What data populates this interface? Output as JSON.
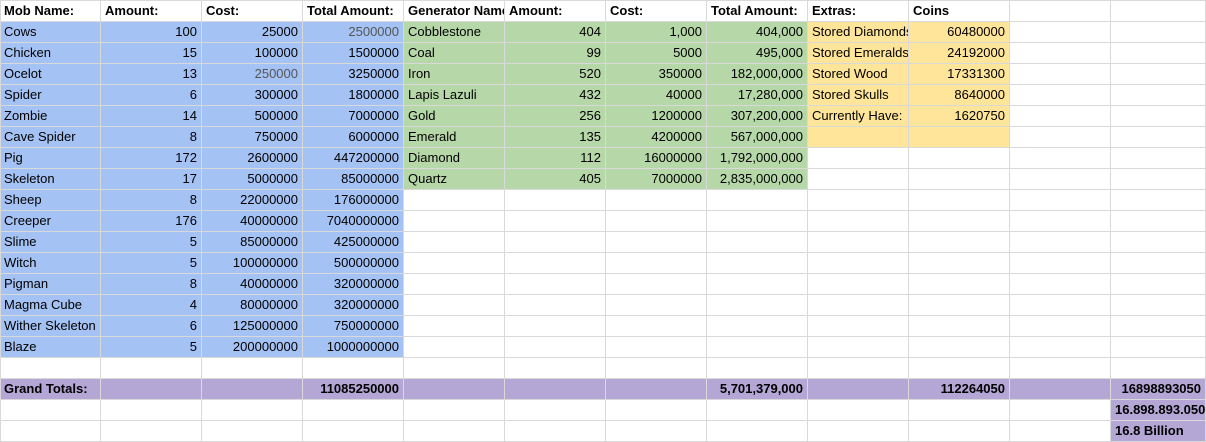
{
  "headers": [
    "Mob Name:",
    "Amount:",
    "Cost:",
    "Total Amount:",
    "Generator Name:",
    "Amount:",
    "Cost:",
    "Total Amount:",
    "Extras:",
    "Coins",
    ""
  ],
  "mobs": [
    {
      "name": "Cows",
      "amount": "100",
      "cost": "25000",
      "total": "2500000"
    },
    {
      "name": "Chicken",
      "amount": "15",
      "cost": "100000",
      "total": "1500000"
    },
    {
      "name": "Ocelot",
      "amount": "13",
      "cost": "250000",
      "total": "3250000"
    },
    {
      "name": "Spider",
      "amount": "6",
      "cost": "300000",
      "total": "1800000"
    },
    {
      "name": "Zombie",
      "amount": "14",
      "cost": "500000",
      "total": "7000000"
    },
    {
      "name": "Cave Spider",
      "amount": "8",
      "cost": "750000",
      "total": "6000000"
    },
    {
      "name": "Pig",
      "amount": "172",
      "cost": "2600000",
      "total": "447200000"
    },
    {
      "name": "Skeleton",
      "amount": "17",
      "cost": "5000000",
      "total": "85000000"
    },
    {
      "name": "Sheep",
      "amount": "8",
      "cost": "22000000",
      "total": "176000000"
    },
    {
      "name": "Creeper",
      "amount": "176",
      "cost": "40000000",
      "total": "7040000000"
    },
    {
      "name": "Slime",
      "amount": "5",
      "cost": "85000000",
      "total": "425000000"
    },
    {
      "name": "Witch",
      "amount": "5",
      "cost": "100000000",
      "total": "500000000"
    },
    {
      "name": "Pigman",
      "amount": "8",
      "cost": "40000000",
      "total": "320000000"
    },
    {
      "name": "Magma Cube",
      "amount": "4",
      "cost": "80000000",
      "total": "320000000"
    },
    {
      "name": "Wither Skeleton",
      "amount": "6",
      "cost": "125000000",
      "total": "750000000"
    },
    {
      "name": "Blaze",
      "amount": "5",
      "cost": "200000000",
      "total": "1000000000"
    }
  ],
  "generators": [
    {
      "name": "Cobblestone",
      "amount": "404",
      "cost": "1,000",
      "total": "404,000"
    },
    {
      "name": "Coal",
      "amount": "99",
      "cost": "5000",
      "total": "495,000"
    },
    {
      "name": "Iron",
      "amount": "520",
      "cost": "350000",
      "total": "182,000,000"
    },
    {
      "name": "Lapis Lazuli",
      "amount": "432",
      "cost": "40000",
      "total": "17,280,000"
    },
    {
      "name": "Gold",
      "amount": "256",
      "cost": "1200000",
      "total": "307,200,000"
    },
    {
      "name": "Emerald",
      "amount": "135",
      "cost": "4200000",
      "total": "567,000,000"
    },
    {
      "name": "Diamond",
      "amount": "112",
      "cost": "16000000",
      "total": "1,792,000,000"
    },
    {
      "name": "Quartz",
      "amount": "405",
      "cost": "7000000",
      "total": "2,835,000,000"
    }
  ],
  "extras": [
    {
      "label": "Stored Diamonds",
      "coins": "60480000"
    },
    {
      "label": "Stored Emeralds",
      "coins": "24192000"
    },
    {
      "label": "Stored Wood",
      "coins": "17331300"
    },
    {
      "label": "Stored Skulls",
      "coins": "8640000"
    },
    {
      "label": "Currently Have:",
      "coins": "1620750"
    }
  ],
  "totals": {
    "label": "Grand Totals:",
    "mob_total": "11085250000",
    "gen_total": "5,701,379,000",
    "coins_total": "112264050",
    "grand": "16898893050",
    "grand_formatted": "16.898.893.050",
    "grand_words": "16.8 Billion"
  },
  "colors": {
    "blue": "#a4c2f4",
    "green": "#b6d7a8",
    "yellow": "#ffe599",
    "purple": "#b4a7d6",
    "grid": "#d9d9d9"
  }
}
